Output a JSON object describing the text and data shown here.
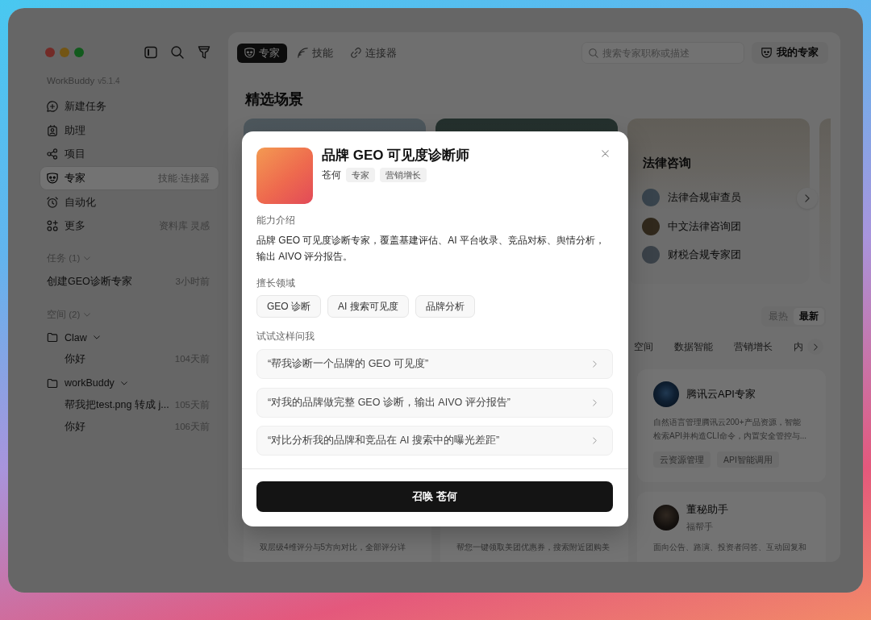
{
  "window": {
    "app_name": "WorkBuddy",
    "version": "v5.1.4"
  },
  "sidebar": {
    "nav": [
      {
        "label": "新建任务",
        "selected": false
      },
      {
        "label": "助理",
        "selected": false
      },
      {
        "label": "项目",
        "selected": false
      },
      {
        "label": "专家",
        "hint": "技能·连接器",
        "selected": true
      },
      {
        "label": "自动化",
        "selected": false
      },
      {
        "label": "更多",
        "hint": "资料库 灵感",
        "selected": false
      }
    ],
    "tasks": {
      "title": "任务 (1)",
      "expanded": true,
      "items": [
        {
          "label": "创建GEO诊断专家",
          "time": "3小时前"
        }
      ]
    },
    "spaces": {
      "title": "空间 (2)",
      "expanded": true,
      "folders": [
        {
          "name": "Claw",
          "expanded": true,
          "children": [
            {
              "label": "你好",
              "time": "104天前"
            }
          ]
        },
        {
          "name": "workBuddy",
          "expanded": true,
          "children": [
            {
              "label": "帮我把test.png 转成 j...",
              "time": "105天前"
            },
            {
              "label": "你好",
              "time": "106天前"
            }
          ]
        }
      ]
    }
  },
  "main": {
    "tabs": [
      {
        "label": "专家",
        "selected": true
      },
      {
        "label": "技能",
        "selected": false
      },
      {
        "label": "连接器",
        "selected": false
      }
    ],
    "search": {
      "placeholder": "搜索专家职称或描述"
    },
    "my_experts_button": "我的专家",
    "featured": {
      "title": "精选场景",
      "scene": {
        "title": "法律咨询",
        "experts": [
          "法律合规审查员",
          "中文法律咨询团",
          "财税合规专家团"
        ]
      }
    },
    "sort": [
      {
        "label": "最热",
        "selected": false
      },
      {
        "label": "最新",
        "selected": true
      }
    ],
    "categories": [
      {
        "label": "空间",
        "selected": false
      },
      {
        "label": "数据智能",
        "selected": false
      },
      {
        "label": "营销增长",
        "selected": false
      },
      {
        "label": "内",
        "selected": false
      }
    ],
    "experts": [
      {
        "name": "腾讯云API专家",
        "description": "自然语言管理腾讯云200+产品资源，智能检索API并构造CLI命令，内置安全管控与...",
        "tags": [
          "云资源管理",
          "API智能调用"
        ]
      },
      {
        "description": "双层级4维评分与5方向对比，全部评分详"
      },
      {
        "description": "帮您一键领取美团优惠券，搜索附近团购美"
      },
      {
        "name": "董秘助手",
        "author": "福帮手",
        "description": "面向公告、路演、投资者问答、互动回复和"
      }
    ]
  },
  "dialog": {
    "title": "品牌 GEO 可见度诊断师",
    "author": "苍何",
    "tags": [
      "专家",
      "营销增长"
    ],
    "intro_label": "能力介绍",
    "intro": "品牌 GEO 可见度诊断专家，覆盖基建评估、AI 平台收录、竞品对标、舆情分析，输出 AIVO 评分报告。",
    "skills_label": "擅长领域",
    "skills": [
      "GEO 诊断",
      "AI 搜索可见度",
      "品牌分析"
    ],
    "prompts_label": "试试这样问我",
    "prompts": [
      "“帮我诊断一个品牌的 GEO 可见度”",
      "“对我的品牌做完整 GEO 诊断，输出 AIVO 评分报告”",
      "“对比分析我的品牌和竞品在 AI 搜索中的曝光差距”"
    ],
    "summon_button": "召唤 苍何"
  }
}
